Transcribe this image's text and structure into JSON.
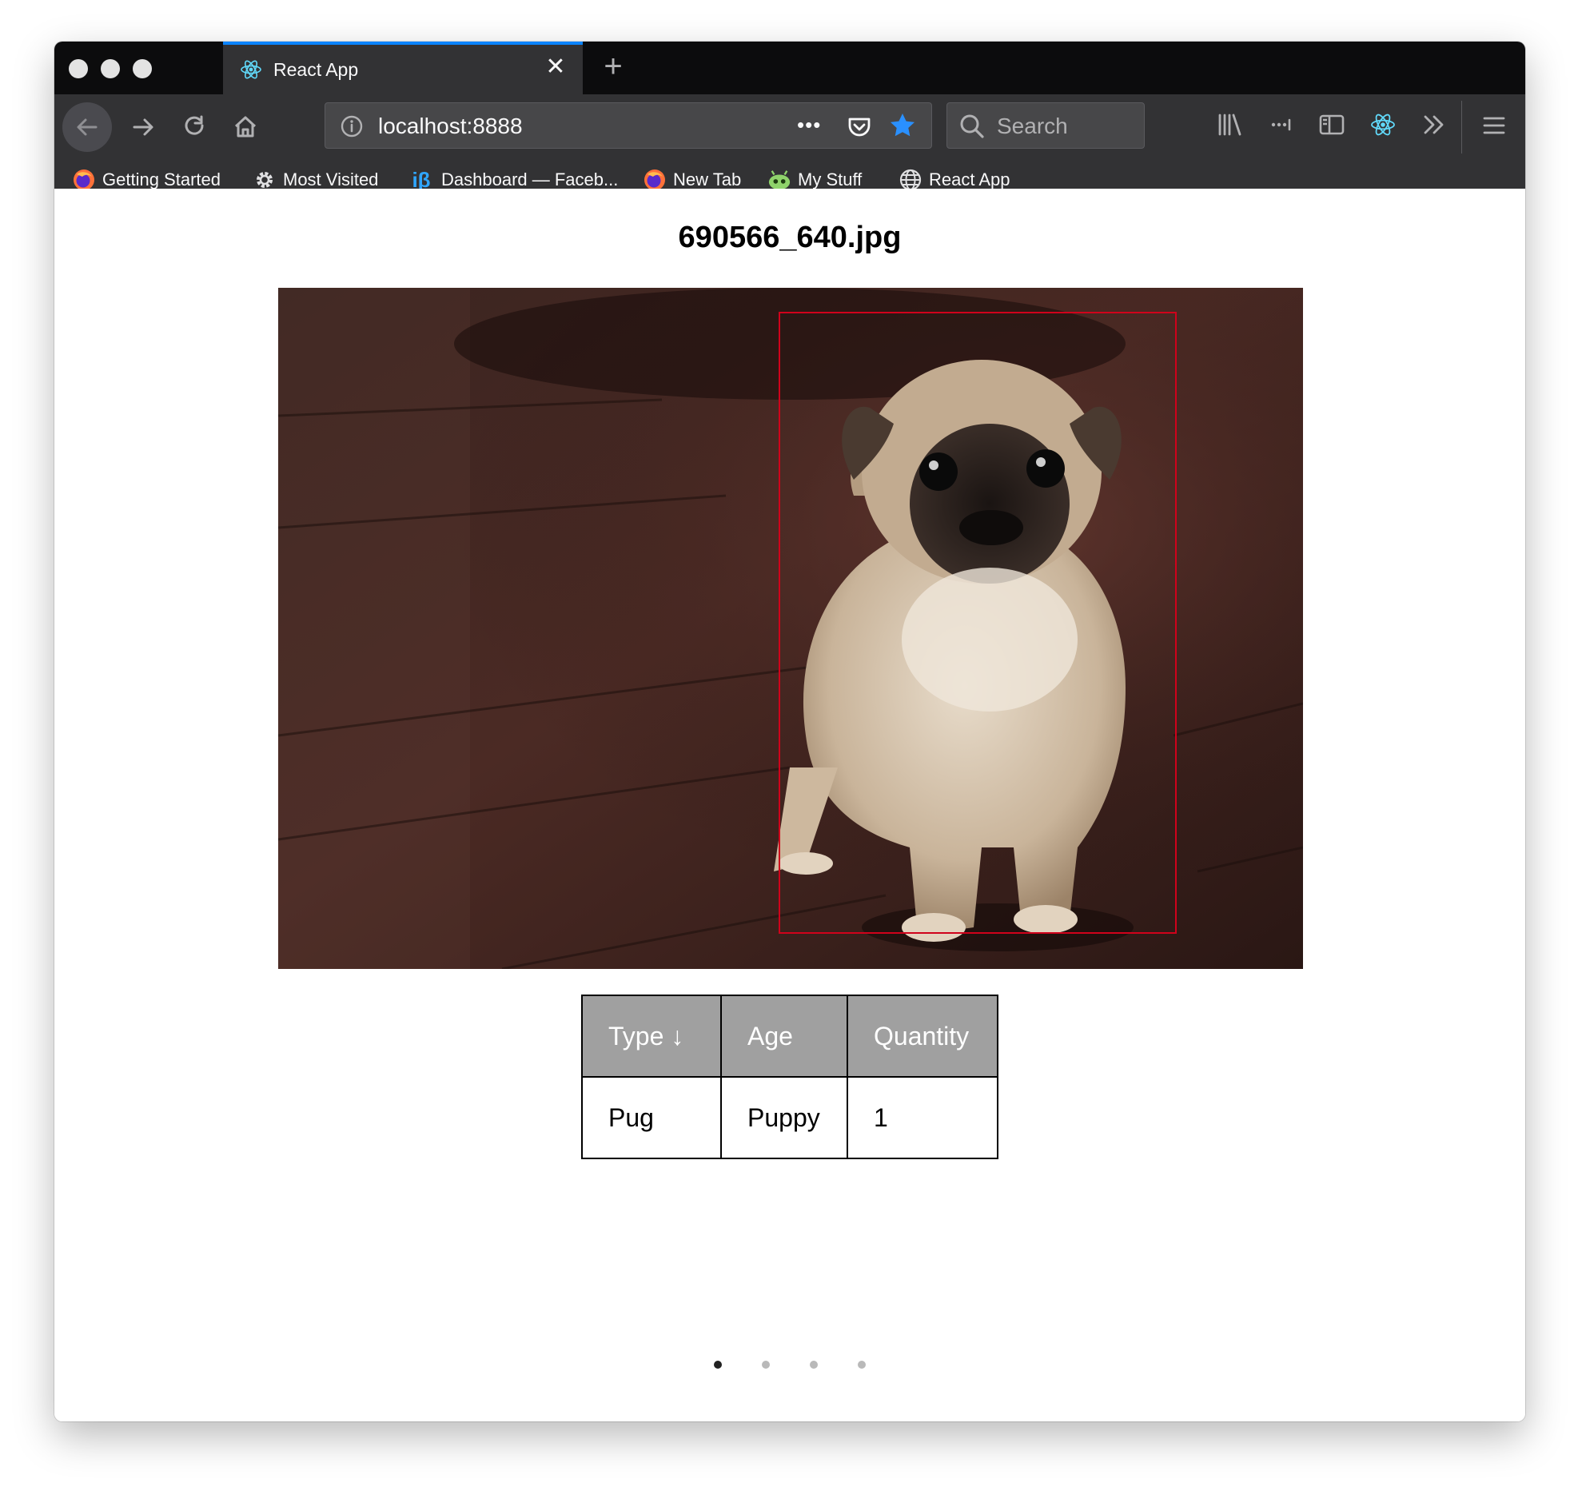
{
  "browser": {
    "tab": {
      "title": "React App",
      "close_glyph": "✕"
    },
    "new_tab_glyph": "+",
    "url": "localhost:8888",
    "search_placeholder": "Search",
    "page_actions_glyph": "•••"
  },
  "bookmarks": [
    {
      "label": "Getting Started",
      "icon": "firefox-icon"
    },
    {
      "label": "Most Visited",
      "icon": "gear-icon"
    },
    {
      "label": "Dashboard — Faceb...",
      "icon": "ib-icon"
    },
    {
      "label": "New Tab",
      "icon": "firefox-icon"
    },
    {
      "label": "My Stuff",
      "icon": "alien-icon"
    },
    {
      "label": "React App",
      "icon": "globe-icon"
    }
  ],
  "page": {
    "title": "690566_640.jpg",
    "table": {
      "headers": [
        "Type ↓",
        "Age",
        "Quantity"
      ],
      "rows": [
        [
          "Pug",
          "Puppy",
          "1"
        ]
      ]
    },
    "carousel": {
      "count": 4,
      "active_index": 0
    }
  },
  "colors": {
    "accent_blue": "#0a84ff",
    "bounding_box": "#d0021b",
    "table_header": "#a0a0a0"
  }
}
